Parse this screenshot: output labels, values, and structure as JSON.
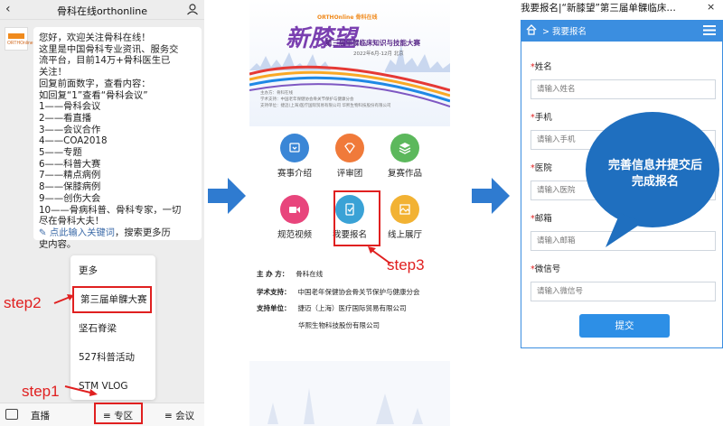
{
  "chat": {
    "title": "骨科在线orthonline",
    "avatar_text": "ORTHOnline",
    "message_lines": [
      "您好，欢迎关注骨科在线！",
      "这里是中国骨科专业资讯、服务交",
      "流平台，目前14万+骨科医生已",
      "关注！",
      " 回复前面数字，查看内容：",
      " 如回复“1”查看“骨科会议”",
      "1——骨科会议",
      "2——看直播",
      "3——会议合作",
      "4——COA2018",
      "5——专题",
      "6——科普大赛",
      "7——精点病例",
      "8——保膝病例",
      "9——创伤大会",
      "10——骨病科普、骨科专家，一切",
      "尽在骨科大夫！"
    ],
    "link_text": "点此输入关键词",
    "link_suffix": "，搜索更多历",
    "link_line2": "史内容。",
    "menu_items": [
      "更多",
      "第三届单髁大赛",
      "坚石脊梁",
      "527科普活动",
      "STM VLOG"
    ],
    "bottom_tabs": [
      "直播",
      "专区",
      "会议"
    ],
    "step1": "step1",
    "step2": "step2"
  },
  "poster": {
    "logo_text": "ORTHOnline 骨科在线",
    "title_main": "新膝望",
    "subtitle": "第三届单髁临床知识与技能大赛",
    "date": "2022年6月-12月  北京",
    "mini_lines": [
      "主办方：骨科在线",
      "学术支持：中国老年保健协会骨关节保护与健康分会",
      "支持单位：捷迈(上海)医疗国际贸易有限公司  华熙生物科技股份有限公司"
    ],
    "grid": [
      "赛事介绍",
      "评审团",
      "复赛作品",
      "规范视频",
      "我要报名",
      "线上展厅"
    ],
    "grid_colors": [
      "#3a86d6",
      "#f07a3a",
      "#5cb85c",
      "#e8457c",
      "#3aa2d6",
      "#f2b233"
    ],
    "info": [
      {
        "key": "主 办 方：",
        "val": "骨科在线"
      },
      {
        "key": "学术支持：",
        "val": "中国老年保健协会骨关节保护与健康分会"
      },
      {
        "key": "支持单位：",
        "val": "捷迈（上海）医疗国际贸易有限公司"
      },
      {
        "key": "",
        "val": "华熙生物科技股份有限公司"
      }
    ],
    "step3": "step3"
  },
  "form": {
    "title": "我要报名|“新膝望”第三届单髁临床…",
    "close": "×",
    "breadcrumb": "> 我要报名",
    "fields": [
      {
        "label": "姓名",
        "placeholder": "请输入姓名"
      },
      {
        "label": "手机",
        "placeholder": "请输入手机"
      },
      {
        "label": "医院",
        "placeholder": "请输入医院"
      },
      {
        "label": "邮箱",
        "placeholder": "请输入邮箱"
      },
      {
        "label": "微信号",
        "placeholder": "请输入微信号"
      }
    ],
    "required_mark": "*",
    "submit": "提交",
    "callout_line1": "完善信息并提交后",
    "callout_line2": "完成报名"
  },
  "colors": {
    "accent_red": "#e02020",
    "arrow_blue": "#2f7bd0",
    "form_blue": "#3b8ee0",
    "callout_blue": "#1f6fbf"
  }
}
